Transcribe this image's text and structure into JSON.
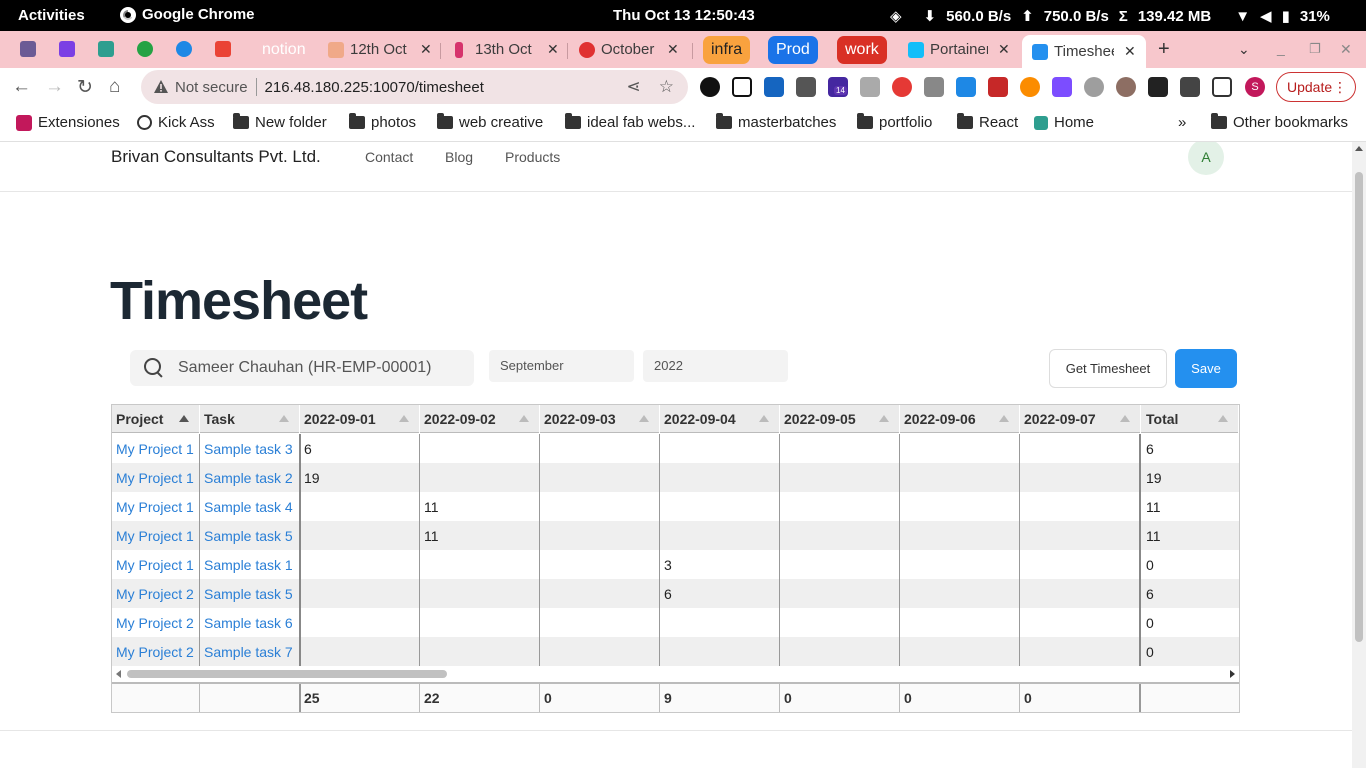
{
  "system_bar": {
    "activities": "Activities",
    "app_name": "Google Chrome",
    "clock": "Thu Oct 13  12:50:43",
    "download": "560.0  B/s",
    "upload": "750.0  B/s",
    "memory": "139.42 MB",
    "battery": "31%"
  },
  "tabs": {
    "group_notion": "notion",
    "tab_12th": "12th Oct",
    "tab_13th": "13th Oct",
    "tab_october": "October",
    "group_infra": "infra",
    "group_prod": "Prod",
    "group_work": "work",
    "tab_portainer": "Portainer",
    "tab_timesheet": "Timesheet",
    "close_glyph": "✕",
    "new_tab_glyph": "+",
    "colors": {
      "notion": "#5f6368",
      "infra": "#f9a23e",
      "prod": "#1a73e8",
      "work": "#d93025"
    }
  },
  "toolbar": {
    "not_secure": "Not secure",
    "url": "216.48.180.225:10070/timesheet",
    "update_label": "Update",
    "profile_initial": "S",
    "ext_badge": "14"
  },
  "bookmarks": {
    "items": [
      "Extensiones",
      "Kick Ass",
      "New folder",
      "photos",
      "web creative",
      "ideal fab webs...",
      "masterbatches",
      "portfolio",
      "React",
      "Home"
    ],
    "overflow": "»",
    "other": "Other bookmarks"
  },
  "site": {
    "brand": "Brivan Consultants Pvt. Ltd.",
    "nav": [
      "Contact",
      "Blog",
      "Products"
    ],
    "avatar_initial": "A"
  },
  "timesheet": {
    "title": "Timesheet",
    "employee": "Sameer Chauhan (HR-EMP-00001)",
    "month": "September",
    "year": "2022",
    "get_button": "Get Timesheet",
    "save_button": "Save",
    "columns": [
      "Project",
      "Task",
      "2022-09-01",
      "2022-09-02",
      "2022-09-03",
      "2022-09-04",
      "2022-09-05",
      "2022-09-06",
      "2022-09-07",
      "Total"
    ],
    "rows": [
      [
        "My Project 1",
        "Sample task 3",
        "6",
        "",
        "",
        "",
        "",
        "",
        "",
        "6"
      ],
      [
        "My Project 1",
        "Sample task 2",
        "19",
        "",
        "",
        "",
        "",
        "",
        "",
        "19"
      ],
      [
        "My Project 1",
        "Sample task 4",
        "",
        "11",
        "",
        "",
        "",
        "",
        "",
        "11"
      ],
      [
        "My Project 1",
        "Sample task 5",
        "",
        "11",
        "",
        "",
        "",
        "",
        "",
        "11"
      ],
      [
        "My Project 1",
        "Sample task 1",
        "",
        "",
        "",
        "3",
        "",
        "",
        "",
        "0"
      ],
      [
        "My Project 2",
        "Sample task 5",
        "",
        "",
        "",
        "6",
        "",
        "",
        "",
        "6"
      ],
      [
        "My Project 2",
        "Sample task 6",
        "",
        "",
        "",
        "",
        "",
        "",
        "",
        "0"
      ],
      [
        "My Project 2",
        "Sample task 7",
        "",
        "",
        "",
        "",
        "",
        "",
        "",
        "0"
      ]
    ],
    "footer": [
      "",
      "",
      "25",
      "22",
      "0",
      "9",
      "0",
      "0",
      "0",
      ""
    ]
  }
}
